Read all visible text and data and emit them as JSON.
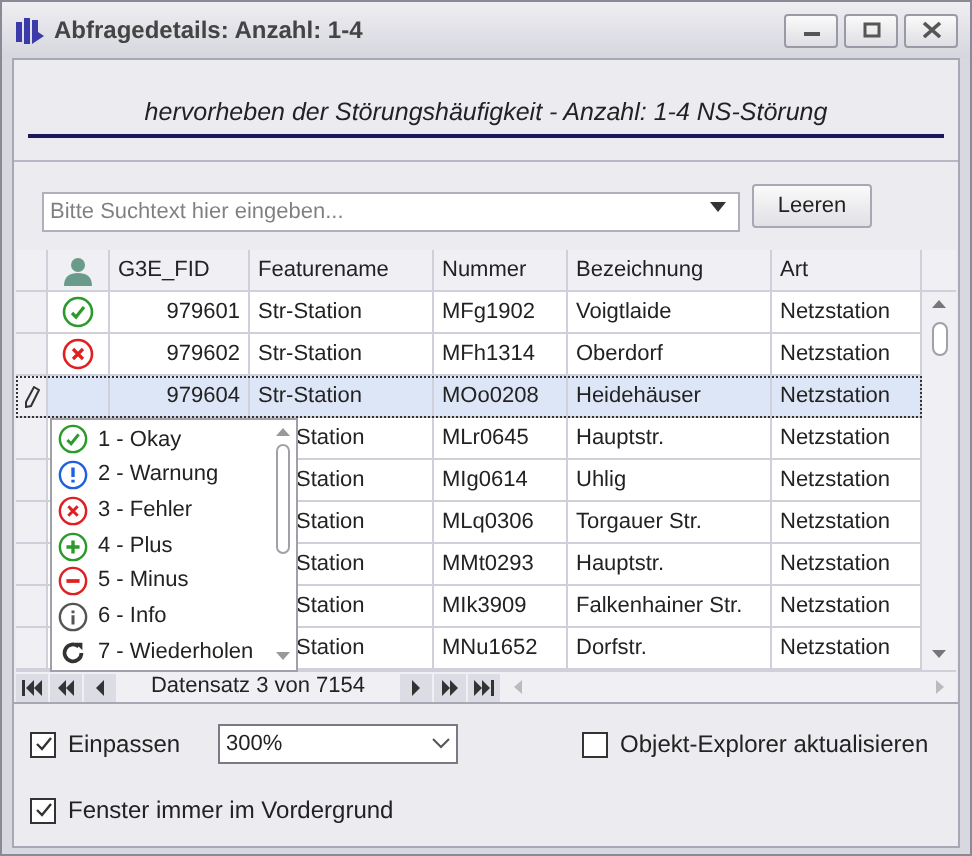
{
  "window": {
    "title": "Abfragedetails: Anzahl: 1-4"
  },
  "heading": "hervorheben der Störungshäufigkeit - Anzahl: 1-4 NS-Störung",
  "search": {
    "placeholder": "Bitte Suchtext hier eingeben...",
    "button": "Leeren"
  },
  "table": {
    "columns": [
      "G3E_FID",
      "Featurename",
      "Nummer",
      "Bezeichnung",
      "Art"
    ],
    "rows": [
      {
        "kind": "ok",
        "fid": "979601",
        "featurename": "Str-Station",
        "nummer": "MFg1902",
        "bezeichnung": "Voigtlaide",
        "art": "Netzstation",
        "selected": false
      },
      {
        "kind": "error",
        "fid": "979602",
        "featurename": "Str-Station",
        "nummer": "MFh1314",
        "bezeichnung": "Oberdorf",
        "art": "Netzstation",
        "selected": false
      },
      {
        "fid": "979604",
        "featurename": "Str-Station",
        "nummer": "MOo0208",
        "bezeichnung": "Heidehäuser",
        "art": "Netzstation",
        "selected": true
      },
      {
        "featurename": "Station",
        "nummer": "MLr0645",
        "bezeichnung": "Hauptstr.",
        "art": "Netzstation",
        "selected": false
      },
      {
        "featurename": "Station",
        "nummer": "MIg0614",
        "bezeichnung": "Uhlig",
        "art": "Netzstation",
        "selected": false
      },
      {
        "featurename": "Station",
        "nummer": "MLq0306",
        "bezeichnung": "Torgauer Str.",
        "art": "Netzstation",
        "selected": false
      },
      {
        "featurename": "Station",
        "nummer": "MMt0293",
        "bezeichnung": "Hauptstr.",
        "art": "Netzstation",
        "selected": false
      },
      {
        "featurename": "Station",
        "nummer": "MIk3909",
        "bezeichnung": "Falkenhainer Str.",
        "art": "Netzstation",
        "selected": false
      },
      {
        "featurename": "Station",
        "nummer": "MNu1652",
        "bezeichnung": "Dorfstr.",
        "art": "Netzstation",
        "selected": false
      }
    ]
  },
  "status_dropdown": [
    {
      "kind": "ok",
      "label": "1 - Okay"
    },
    {
      "kind": "warning",
      "label": "2 - Warnung"
    },
    {
      "kind": "error",
      "label": "3 - Fehler"
    },
    {
      "kind": "plus",
      "label": "4 - Plus"
    },
    {
      "kind": "minus",
      "label": "5 - Minus"
    },
    {
      "kind": "info",
      "label": "6 - Info"
    },
    {
      "kind": "repeat",
      "label": "7 - Wiederholen"
    }
  ],
  "navigator": {
    "text": "Datensatz 3 von 7154"
  },
  "options": {
    "fit": {
      "label": "Einpassen",
      "checked": true
    },
    "zoom": "300%",
    "explorer": {
      "label": "Objekt-Explorer aktualisieren",
      "checked": false
    },
    "topmost": {
      "label": "Fenster immer im Vordergrund",
      "checked": true
    }
  }
}
